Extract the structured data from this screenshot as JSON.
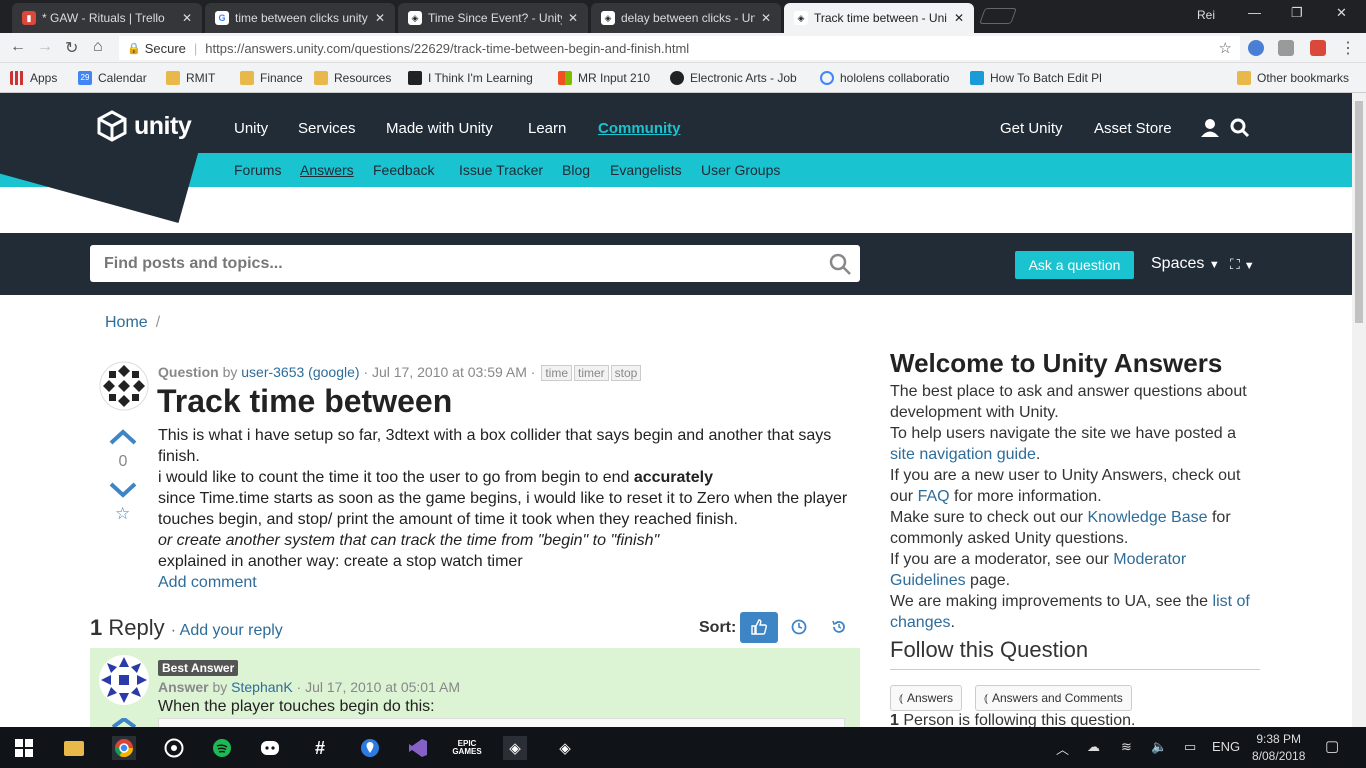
{
  "browser": {
    "tabs": [
      {
        "title": "* GAW - Rituals | Trello",
        "icon": "trello-icon",
        "color": "#d9483b"
      },
      {
        "title": "time between clicks unity",
        "icon": "google-icon",
        "color": "#4285f4"
      },
      {
        "title": "Time Since Event? - Unity",
        "icon": "unity-icon",
        "color": "#222"
      },
      {
        "title": "delay between clicks - Uni",
        "icon": "unity-icon",
        "color": "#222"
      },
      {
        "title": "Track time between - Uni",
        "icon": "unity-icon",
        "color": "#222"
      }
    ],
    "user": "Rei",
    "secure_label": "Secure",
    "url": "https://answers.unity.com/questions/22629/track-time-between-begin-and-finish.html",
    "bookmarks": [
      "Apps",
      "Calendar",
      "RMIT",
      "Finance",
      "Resources",
      "I Think I'm Learning",
      "MR Input 210",
      "Electronic Arts - Job",
      "hololens collaboratio",
      "How To Batch Edit Pl",
      "Other bookmarks"
    ],
    "calendar_day": "29"
  },
  "site": {
    "logo_text": "unity",
    "nav": [
      "Unity",
      "Services",
      "Made with Unity",
      "Learn",
      "Community"
    ],
    "nav_right": [
      "Get Unity",
      "Asset Store"
    ],
    "subnav": [
      "Forums",
      "Answers",
      "Feedback",
      "Issue Tracker",
      "Blog",
      "Evangelists",
      "User Groups"
    ],
    "search_placeholder": "Find posts and topics...",
    "ask_button": "Ask a question",
    "spaces_label": "Spaces",
    "accent": "#19c3d0",
    "dark": "#222c37"
  },
  "breadcrumb": {
    "home": "Home",
    "separator": "/"
  },
  "question": {
    "type": "Question",
    "by": "by",
    "author": "user-3653 (google)",
    "date": "· Jul 17, 2010 at 03:59 AM ·",
    "tags": [
      "time",
      "timer",
      "stop"
    ],
    "title": "Track time between",
    "votes": "0",
    "body": {
      "p1": "This is what i have setup so far, 3dtext with a box collider that says begin and another that says finish.",
      "p2a": "i would like to count the time it too the user to go from begin to end ",
      "p2b": "accurately",
      "p3": "since Time.time starts as soon as the game begins, i would like to reset it to Zero when the player touches begin, and stop/ print the amount of time it took when they reached finish.",
      "p4": "or create another system that can track the time from \"begin\" to \"finish\"",
      "p5": "explained in another way: create a stop watch timer"
    },
    "add_comment": "Add comment"
  },
  "replies": {
    "count": "1",
    "label": "Reply",
    "add_reply": "· Add your reply",
    "sort_label": "Sort:"
  },
  "answer": {
    "badge": "Best Answer",
    "type": "Answer",
    "by": "by",
    "author": "StephanK",
    "date": "· Jul 17, 2010 at 05:01 AM",
    "body": "When the player touches begin do this:"
  },
  "sidebar": {
    "title": "Welcome to Unity Answers",
    "s1": "The best place to ask and answer questions about development with Unity.",
    "s2a": "To help users navigate the site we have posted a ",
    "s2link": "site navigation guide",
    "s2b": ".",
    "s3a": "If you are a new user to Unity Answers, check out our ",
    "s3link": "FAQ",
    "s3b": " for more information.",
    "s4a": "Make sure to check out our ",
    "s4link": "Knowledge Base",
    "s4b": " for commonly asked Unity questions.",
    "s5a": "If you are a moderator, see our ",
    "s5link": "Moderator Guidelines",
    "s5b": " page.",
    "s6a": "We are making improvements to UA, see the ",
    "s6link": "list of changes",
    "s6b": ".",
    "follow_title": "Follow this Question",
    "btn_answers": "Answers",
    "btn_answers_comments": "Answers and Comments",
    "follow_count": "1",
    "follow_text": " Person is following this question."
  },
  "taskbar": {
    "lang": "ENG",
    "time": "9:38 PM",
    "date": "8/08/2018"
  }
}
